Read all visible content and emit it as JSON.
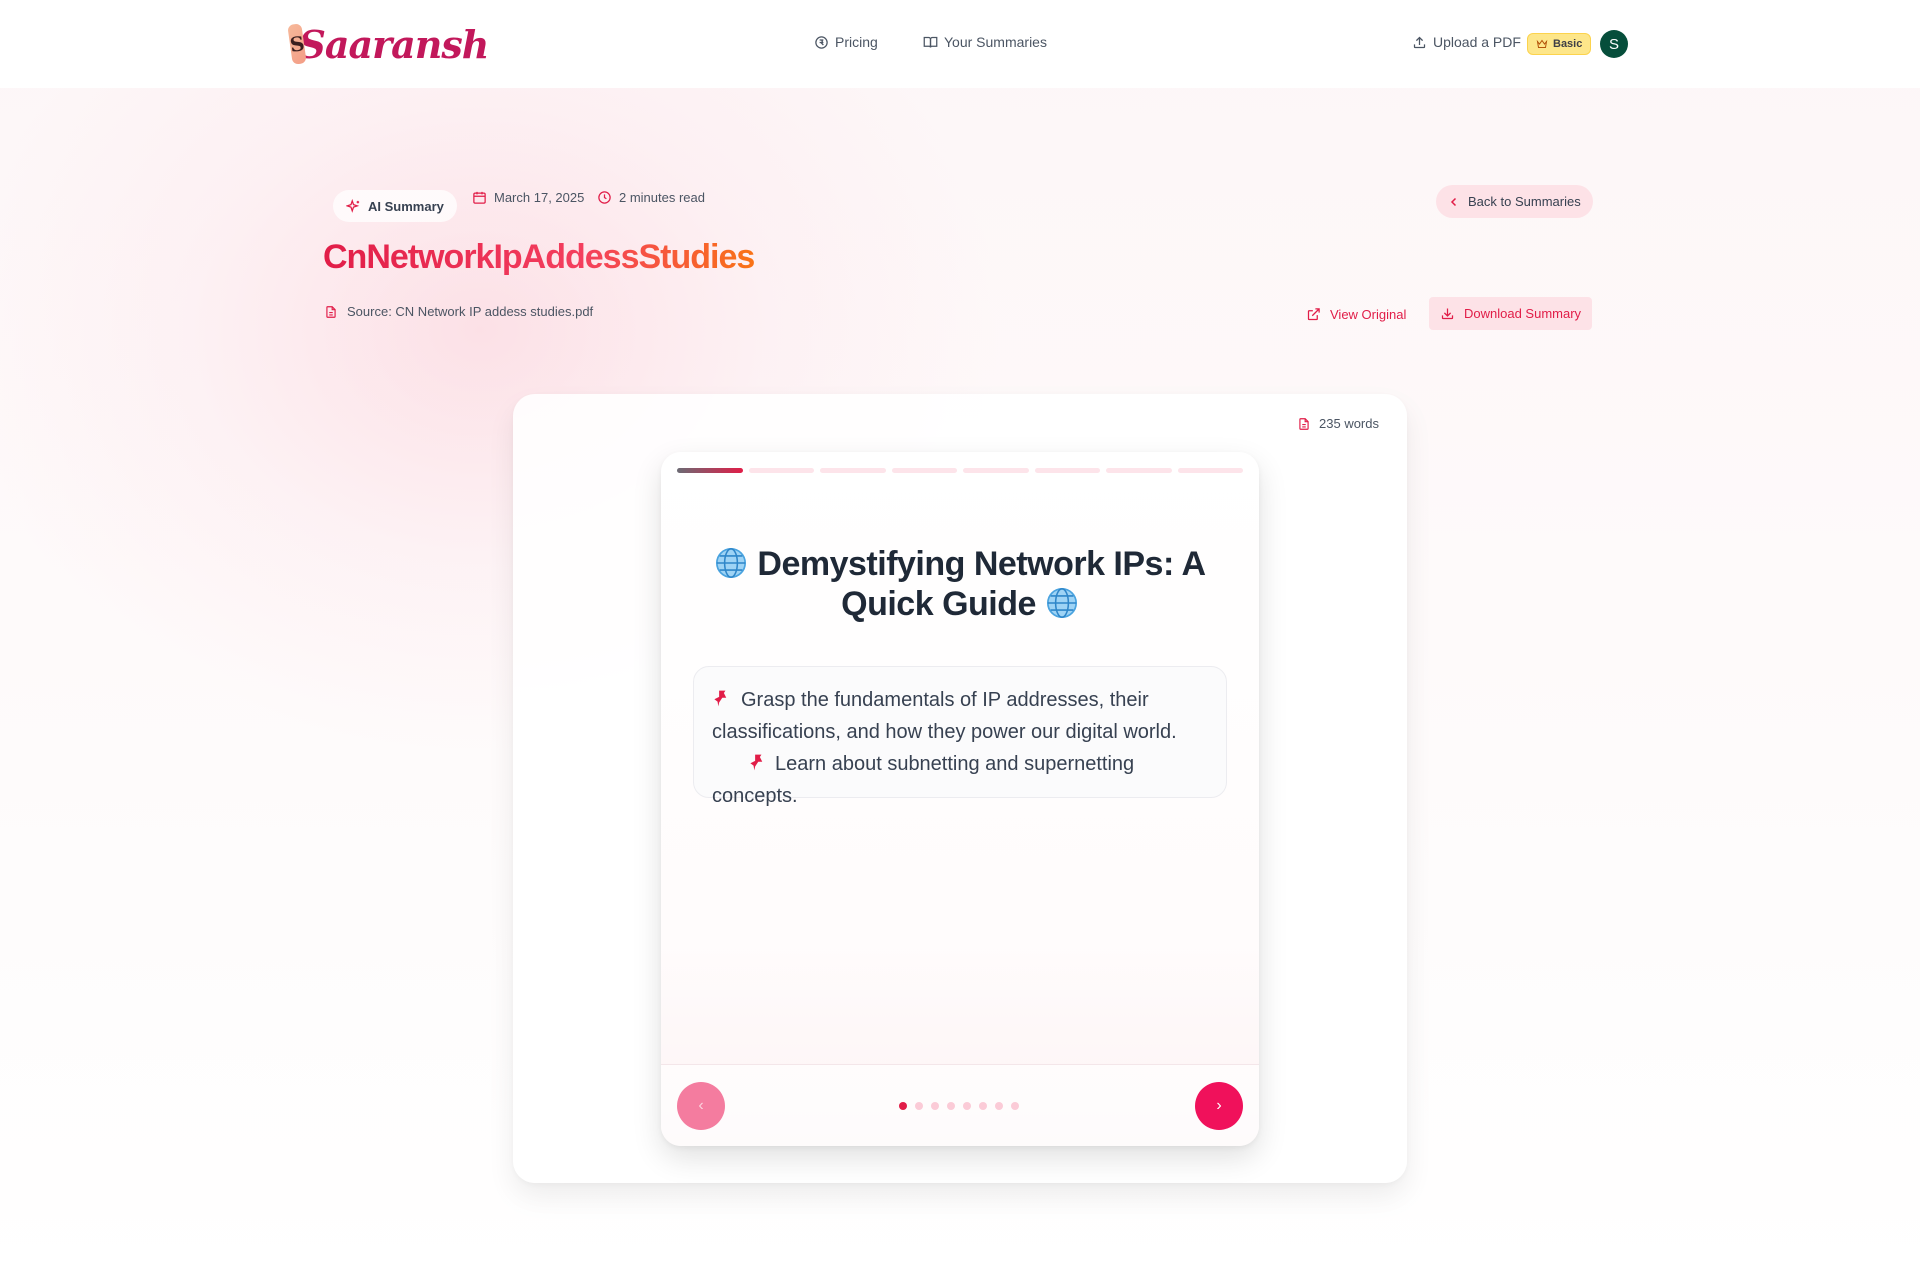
{
  "header": {
    "logo_text": "Saaransh",
    "logo_mark": "S",
    "nav": {
      "pricing": "Pricing",
      "summaries": "Your Summaries",
      "upload": "Upload a PDF"
    },
    "plan_badge": "Basic",
    "avatar_initial": "S"
  },
  "summary": {
    "ai_label": "AI Summary",
    "date": "March 17, 2025",
    "read_time": "2 minutes read",
    "back_label": "Back to Summaries",
    "title": "CnNetworkIpAddessStudies",
    "source": "Source: CN Network IP addess studies.pdf",
    "view_original": "View Original",
    "download": "Download Summary"
  },
  "viewer": {
    "word_count": "235 words",
    "total_sections": 8,
    "current_section": 1,
    "card_title": "Demystifying Network IPs: A Quick Guide",
    "points": [
      "Grasp the fundamentals of IP addresses, their classifications, and how they power our digital world.",
      "Learn about subnetting and supernetting concepts."
    ],
    "prev_symbol": "‹",
    "next_symbol": "›"
  },
  "colors": {
    "accent": "#e11d48",
    "badge": "#fde68a",
    "avatar": "#064e3b"
  },
  "icons": [
    "pricing-icon",
    "book-icon",
    "upload-icon",
    "crown-icon",
    "sparkles-icon",
    "calendar-icon",
    "clock-icon",
    "chevron-left-icon",
    "file-icon",
    "external-link-icon",
    "download-icon",
    "globe-icon",
    "pushpin-icon"
  ]
}
